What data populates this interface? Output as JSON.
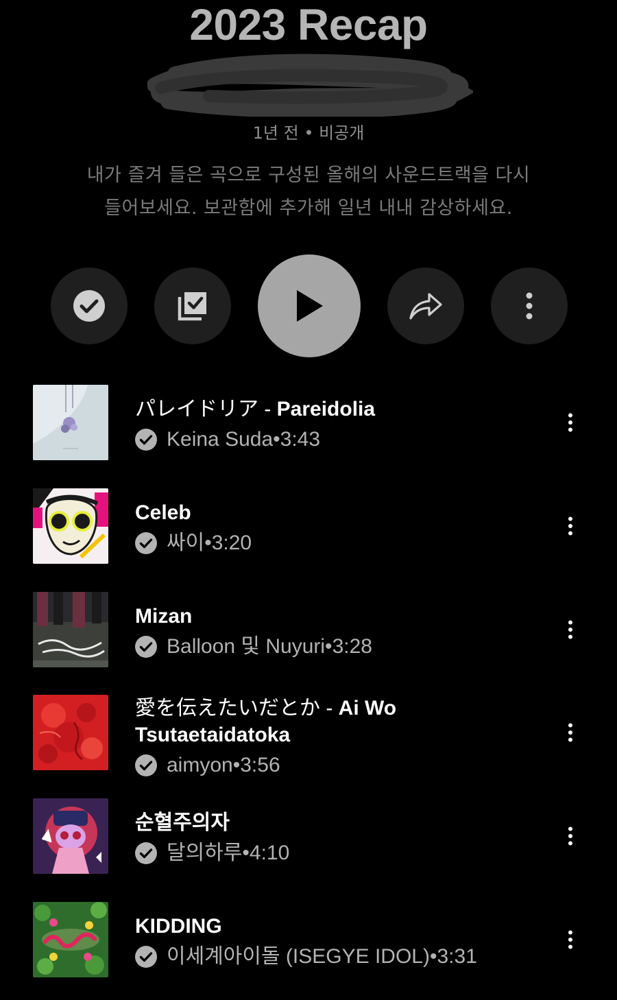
{
  "playlist": {
    "title": "2023 Recap",
    "meta": "1년 전 • 비공개",
    "description_line1": "내가 즐겨 들은 곡으로 구성된 올해의 사운드트랙을 다시",
    "description_line2": "들어보세요. 보관함에 추가해 일년 내내 감상하세요."
  },
  "actions": [
    {
      "name": "saved-button",
      "icon": "check-circle-icon"
    },
    {
      "name": "add-to-library-button",
      "icon": "library-check-icon"
    },
    {
      "name": "play-button",
      "icon": "play-icon"
    },
    {
      "name": "share-button",
      "icon": "share-arrow-icon"
    },
    {
      "name": "more-options-button",
      "icon": "more-vert-icon"
    }
  ],
  "tracks": [
    {
      "title_jp": "パレイドリア - ",
      "title_en": "Pareidolia",
      "artist": "Keina Suda",
      "duration": "3:43",
      "art_color": "#dfe6ea"
    },
    {
      "title_jp": "",
      "title_en": "Celeb",
      "artist": "싸이",
      "duration": "3:20",
      "art_color": "#f0e0e8"
    },
    {
      "title_jp": "",
      "title_en": "Mizan",
      "artist": "Balloon 및 Nuyuri",
      "duration": "3:28",
      "art_color": "#3e3f3c"
    },
    {
      "title_jp": "愛を伝えたいだとか - ",
      "title_en": "Ai Wo Tsutaetaidatoka",
      "artist": "aimyon",
      "duration": "3:56",
      "art_color": "#d42424"
    },
    {
      "title_jp": "",
      "title_en": "순혈주의자",
      "artist": "달의하루",
      "duration": "4:10",
      "art_color": "#5a2d6a"
    },
    {
      "title_jp": "",
      "title_en": "KIDDING",
      "artist": "이세계아이돌 (ISEGYE IDOL)",
      "duration": "3:31",
      "art_color": "#2e6b2a"
    }
  ],
  "separator": " • "
}
